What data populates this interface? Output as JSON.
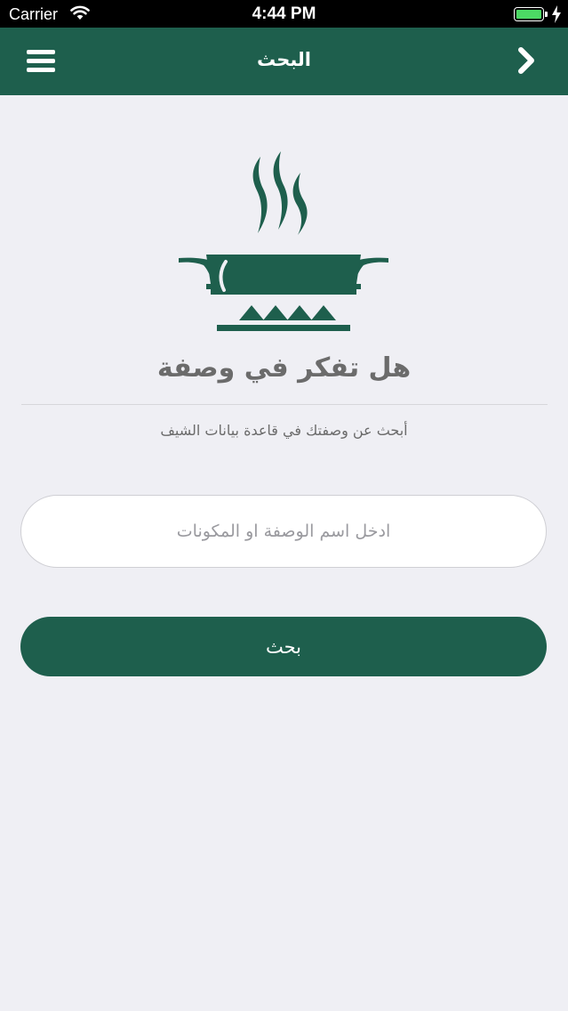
{
  "status_bar": {
    "carrier": "Carrier",
    "time": "4:44 PM"
  },
  "nav": {
    "title": "البحث",
    "left_icon": "hamburger-menu-icon",
    "right_icon": "chevron-right-icon"
  },
  "hero": {
    "icon": "steaming-pot-on-stove-icon",
    "headline": "هل تفكر في وصفة",
    "subtitle": "أبحث عن وصفتك في قاعدة بيانات الشيف"
  },
  "search": {
    "placeholder": "ادخل اسم الوصفة او المكونات",
    "value": "",
    "button_label": "بحث"
  },
  "colors": {
    "brand": "#1e5f4d",
    "background": "#efeff4",
    "text_muted": "#6b6b6b",
    "battery": "#4cd964"
  }
}
